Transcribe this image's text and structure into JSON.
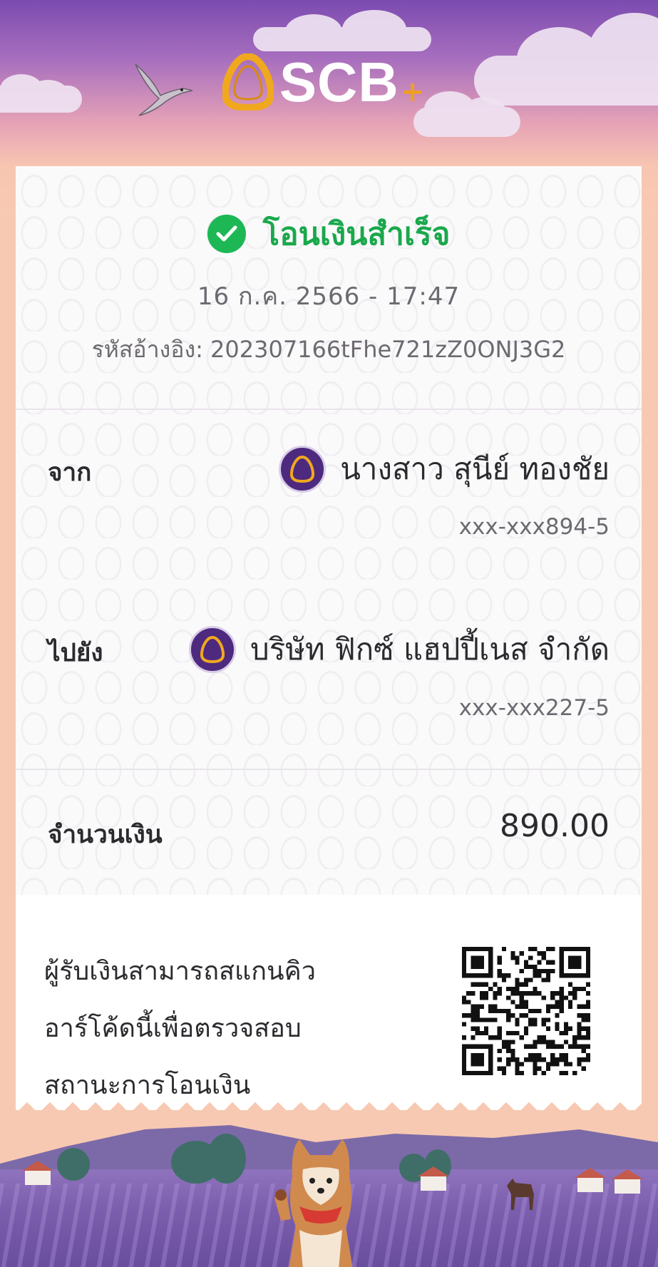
{
  "header": {
    "brand": "SCB",
    "brand_plus": "+"
  },
  "receipt": {
    "status": "โอนเงินสำเร็จ",
    "datetime": "16 ก.ค. 2566 - 17:47",
    "reference_label": "รหัสอ้างอิง:",
    "reference_value": "202307166tFhe721zZ0ONJ3G2",
    "from": {
      "label": "จาก",
      "name": "นางสาว สุนีย์ ทองชัย",
      "account": "xxx-xxx894-5",
      "icon": "scb-bank-icon"
    },
    "to": {
      "label": "ไปยัง",
      "name": "บริษัท ฟิกซ์ แฮปปี้เนส จำกัด",
      "account": "xxx-xxx227-5",
      "icon": "scb-bank-icon"
    },
    "amount": {
      "label": "จำนวนเงิน",
      "value": "890.00"
    },
    "qr_note": {
      "line1": "ผู้รับเงินสามารถสแกนคิว",
      "line2": "อาร์โค้ดนี้เพื่อตรวจสอบ",
      "line3": "สถานะการโอนเงิน"
    }
  },
  "colors": {
    "brand_purple": "#4d2a7e",
    "success_green": "#1db855",
    "brand_gold": "#f0a020"
  }
}
